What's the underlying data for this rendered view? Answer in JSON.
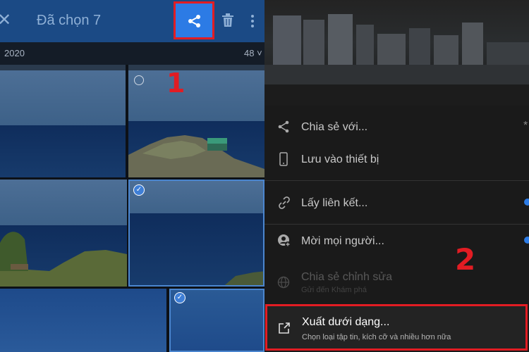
{
  "left_screen": {
    "header": {
      "close_icon": "close-icon",
      "title": "Đã chọn 7",
      "share_icon": "share-icon",
      "delete_icon": "trash-icon",
      "more_icon": "more-vertical-icon"
    },
    "date_bar": {
      "year": "2020",
      "count": "48 ˅"
    },
    "step_label": "1"
  },
  "right_screen": {
    "menu": [
      {
        "label": "Chia sẻ với...",
        "icon": "share-icon"
      },
      {
        "label": "Lưu vào thiết bị",
        "icon": "phone-icon"
      },
      {
        "label": "Lấy liên kết...",
        "icon": "link-icon"
      },
      {
        "label": "Mời mọi người...",
        "icon": "add-person-icon"
      },
      {
        "label": "Chia sẻ chỉnh sửa",
        "sublabel": "Gửi đến Khám phá",
        "icon": "globe-icon",
        "disabled": true
      },
      {
        "label": "Xuất dưới dạng...",
        "sublabel": "Chọn loại tập tin, kích cỡ và nhiều hơn nữa",
        "icon": "export-icon"
      }
    ],
    "step_label": "2"
  },
  "colors": {
    "highlight_border": "#e21c23",
    "accent_blue": "#2c7be5",
    "header_blue": "#1b4a85",
    "step_red": "#e21c23"
  }
}
